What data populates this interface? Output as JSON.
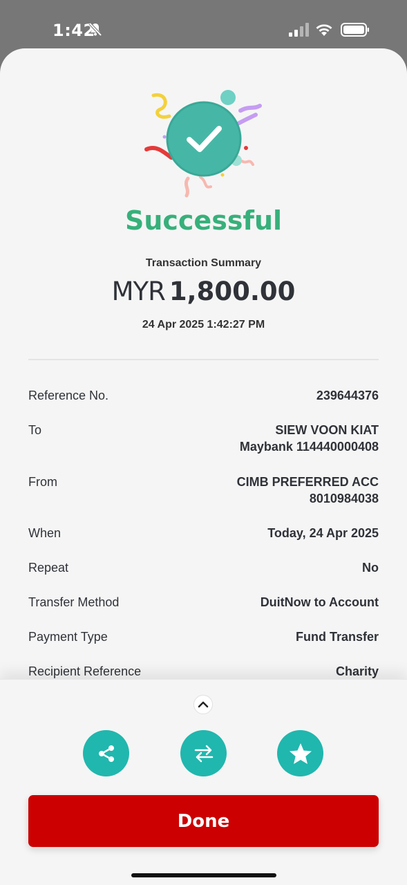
{
  "status_bar": {
    "time": "1:42",
    "icons": [
      "bell-off-icon",
      "signal-icon",
      "wifi-icon",
      "battery-icon"
    ]
  },
  "result": {
    "status_text": "Successful",
    "summary_label": "Transaction Summary",
    "currency": "MYR",
    "amount": "1,800.00",
    "datetime": "24 Apr 2025 1:42:27 PM"
  },
  "details": {
    "reference": {
      "label": "Reference No.",
      "value": "239644376"
    },
    "to": {
      "label": "To",
      "line1": "SIEW VOON KIAT",
      "line2": "Maybank 114440000408"
    },
    "from": {
      "label": "From",
      "line1": "CIMB PREFERRED ACC",
      "line2": "8010984038"
    },
    "when": {
      "label": "When",
      "value": "Today, 24 Apr 2025"
    },
    "repeat": {
      "label": "Repeat",
      "value": "No"
    },
    "transfer_method": {
      "label": "Transfer Method",
      "value": "DuitNow to Account"
    },
    "payment_type": {
      "label": "Payment Type",
      "value": "Fund Transfer"
    },
    "recipient_reference": {
      "label": "Recipient Reference",
      "value": "Charity"
    }
  },
  "actions": {
    "expand_icon": "chevron-up-icon",
    "share_icon": "share-icon",
    "transfer_icon": "transfer-icon",
    "favourite_icon": "star-icon",
    "done_label": "Done"
  },
  "colors": {
    "success": "#37b07b",
    "accent_teal": "#20b7ae",
    "primary_red": "#cc0000"
  }
}
